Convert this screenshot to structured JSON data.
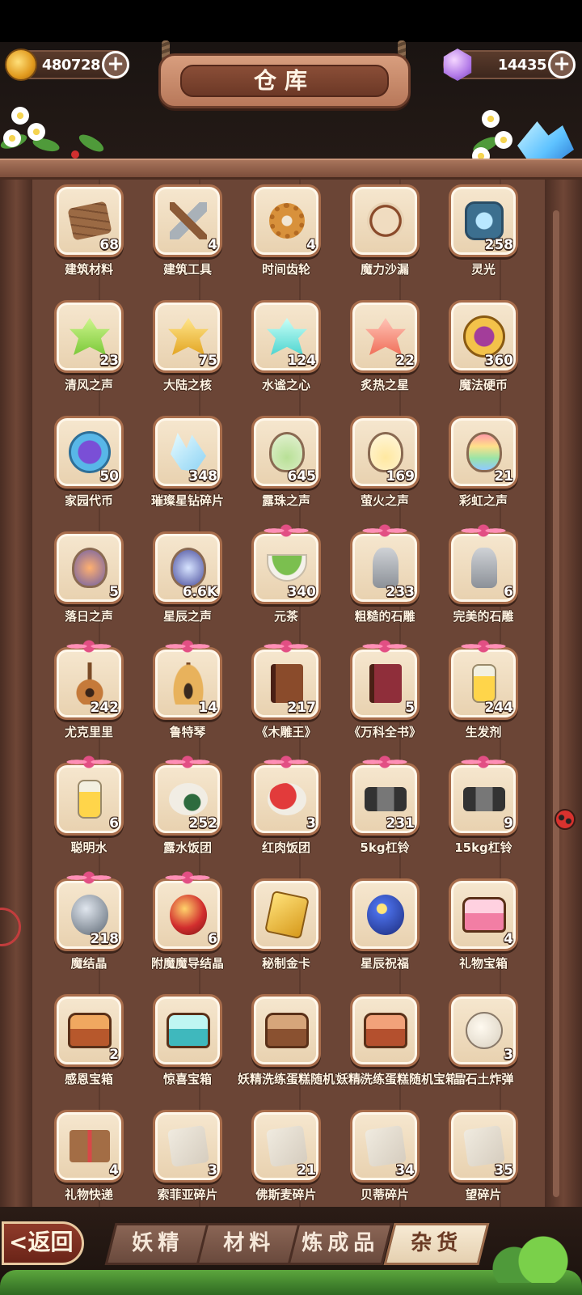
{
  "header": {
    "title": "仓库",
    "gold": {
      "value": "480728",
      "plus": "+"
    },
    "gems": {
      "value": "14435",
      "plus": "+"
    }
  },
  "items": [
    {
      "name": "建筑材料",
      "count": "68",
      "icon": "planks-icon",
      "cls": "s-plank",
      "pink": false
    },
    {
      "name": "建筑工具",
      "count": "4",
      "icon": "tools-icon",
      "cls": "s-tool",
      "pink": false
    },
    {
      "name": "时间齿轮",
      "count": "4",
      "icon": "gear-icon",
      "cls": "s-gear",
      "pink": false
    },
    {
      "name": "魔力沙漏",
      "count": "",
      "icon": "hourglass-icon",
      "cls": "s-hourglass",
      "pink": false
    },
    {
      "name": "灵光",
      "count": "258",
      "icon": "rune-icon",
      "cls": "s-rune",
      "pink": false
    },
    {
      "name": "清风之声",
      "count": "23",
      "icon": "green-crystal-icon",
      "cls": "s-leaf c-green",
      "pink": false
    },
    {
      "name": "大陆之核",
      "count": "75",
      "icon": "gold-crystal-icon",
      "cls": "s-leaf c-gold",
      "pink": false
    },
    {
      "name": "水谧之心",
      "count": "124",
      "icon": "cyan-crystal-icon",
      "cls": "s-leaf c-cyan",
      "pink": false
    },
    {
      "name": "炙热之星",
      "count": "22",
      "icon": "red-crystal-icon",
      "cls": "s-leaf c-red",
      "pink": false
    },
    {
      "name": "魔法硬币",
      "count": "360",
      "icon": "magic-coin-icon",
      "cls": "s-coin",
      "pink": false
    },
    {
      "name": "家园代币",
      "count": "50",
      "icon": "star-token-icon",
      "cls": "s-token",
      "pink": false
    },
    {
      "name": "璀璨星钻碎片",
      "count": "348",
      "icon": "diamond-shard-icon",
      "cls": "s-shard",
      "pink": false
    },
    {
      "name": "露珠之声",
      "count": "645",
      "icon": "dew-bottle-icon",
      "cls": "s-bottle b-green",
      "pink": false
    },
    {
      "name": "萤火之声",
      "count": "169",
      "icon": "firefly-bottle-icon",
      "cls": "s-bottle b-yellow",
      "pink": false
    },
    {
      "name": "彩虹之声",
      "count": "21",
      "icon": "rainbow-bottle-icon",
      "cls": "s-bottle b-rainbow",
      "pink": false
    },
    {
      "name": "落日之声",
      "count": "5",
      "icon": "sunset-bottle-icon",
      "cls": "s-bottle b-sunset",
      "pink": false
    },
    {
      "name": "星辰之声",
      "count": "6.6K",
      "icon": "star-bottle-icon",
      "cls": "s-bottle b-star",
      "pink": false
    },
    {
      "name": "元茶",
      "count": "340",
      "icon": "tea-bowl-icon",
      "cls": "s-tea",
      "pink": true
    },
    {
      "name": "粗糙的石雕",
      "count": "233",
      "icon": "rough-statue-icon",
      "cls": "s-statue",
      "pink": true
    },
    {
      "name": "完美的石雕",
      "count": "6",
      "icon": "perfect-statue-icon",
      "cls": "s-statue",
      "pink": true
    },
    {
      "name": "尤克里里",
      "count": "242",
      "icon": "ukulele-icon",
      "cls": "s-guitar",
      "pink": true
    },
    {
      "name": "鲁特琴",
      "count": "14",
      "icon": "lute-icon",
      "cls": "s-lute",
      "pink": true
    },
    {
      "name": "《木雕王》",
      "count": "217",
      "icon": "brown-book-icon",
      "cls": "s-book bk-brown",
      "pink": true
    },
    {
      "name": "《万科全书》",
      "count": "5",
      "icon": "red-book-icon",
      "cls": "s-book bk-red",
      "pink": true
    },
    {
      "name": "生发剂",
      "count": "244",
      "icon": "hair-tonic-icon",
      "cls": "s-jar",
      "pink": true
    },
    {
      "name": "聪明水",
      "count": "6",
      "icon": "smart-water-icon",
      "cls": "s-jar",
      "pink": true
    },
    {
      "name": "露水饭团",
      "count": "252",
      "icon": "rice-ball-icon",
      "cls": "s-ball r-white",
      "pink": true
    },
    {
      "name": "红肉饭团",
      "count": "3",
      "icon": "meat-rice-ball-icon",
      "cls": "s-ball r-red",
      "pink": true
    },
    {
      "name": "5kg杠铃",
      "count": "231",
      "icon": "dumbbell-icon",
      "cls": "s-dumb",
      "pink": true
    },
    {
      "name": "15kg杠铃",
      "count": "9",
      "icon": "heavy-dumbbell-icon",
      "cls": "s-dumb",
      "pink": true
    },
    {
      "name": "魔结晶",
      "count": "218",
      "icon": "gray-crystal-icon",
      "cls": "s-orb o-gray",
      "pink": true
    },
    {
      "name": "附魔魔导结晶",
      "count": "6",
      "icon": "red-orb-icon",
      "cls": "s-orb o-red",
      "pink": true
    },
    {
      "name": "秘制金卡",
      "count": "",
      "icon": "gold-card-icon",
      "cls": "s-card",
      "pink": false
    },
    {
      "name": "星辰祝福",
      "count": "",
      "icon": "star-blessing-icon",
      "cls": "s-orb o-blue",
      "pink": false
    },
    {
      "name": "礼物宝箱",
      "count": "4",
      "icon": "gift-chest-icon",
      "cls": "s-chest ch-pink",
      "pink": false
    },
    {
      "name": "感恩宝箱",
      "count": "2",
      "icon": "gratitude-chest-icon",
      "cls": "s-chest ch-gold",
      "pink": false
    },
    {
      "name": "惊喜宝箱",
      "count": "",
      "icon": "surprise-chest-icon",
      "cls": "s-chest ch-teal",
      "pink": false
    },
    {
      "name": "妖精洗练蛋糕随机宝箱A",
      "count": "",
      "icon": "cake-chest-a-icon",
      "cls": "s-chest ch-brown",
      "pink": false
    },
    {
      "name": "妖精洗练蛋糕随机宝箱B",
      "count": "",
      "icon": "cake-chest-b-icon",
      "cls": "s-chest ch-copper",
      "pink": false
    },
    {
      "name": "晶石土炸弹",
      "count": "3",
      "icon": "bomb-icon",
      "cls": "s-bomb",
      "pink": false
    },
    {
      "name": "礼物快递",
      "count": "4",
      "icon": "parcel-icon",
      "cls": "s-parcel",
      "pink": false
    },
    {
      "name": "索菲亚碎片",
      "count": "3",
      "icon": "puzzle-icon",
      "cls": "s-puzzle",
      "pink": false
    },
    {
      "name": "佛斯麦碎片",
      "count": "21",
      "icon": "puzzle-icon",
      "cls": "s-puzzle",
      "pink": false
    },
    {
      "name": "贝蒂碎片",
      "count": "34",
      "icon": "puzzle-icon",
      "cls": "s-puzzle",
      "pink": false
    },
    {
      "name": "望碎片",
      "count": "35",
      "icon": "puzzle-icon",
      "cls": "s-puzzle",
      "pink": false
    }
  ],
  "nav": {
    "back": "<返回",
    "tabs": [
      "妖精",
      "材料",
      "炼成品",
      "杂货"
    ],
    "active_tab": "杂货"
  }
}
